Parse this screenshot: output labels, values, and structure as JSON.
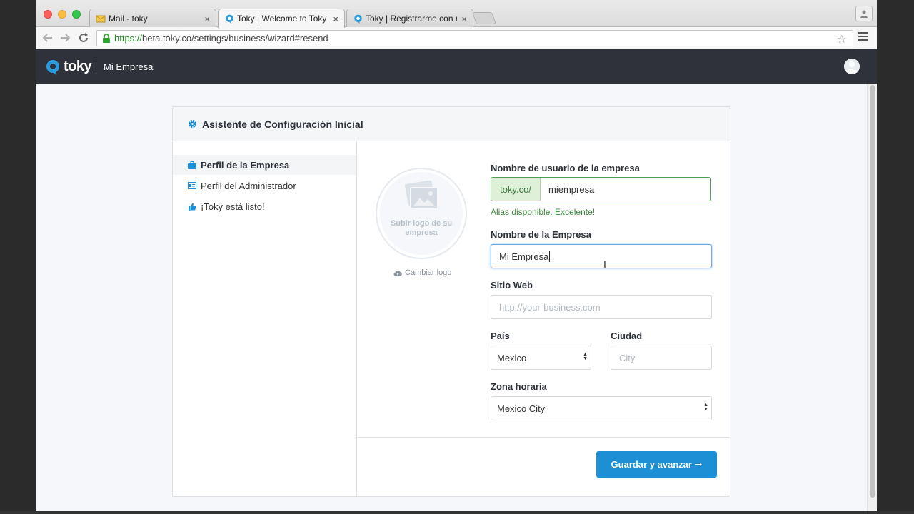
{
  "browser": {
    "tabs": [
      {
        "title": "Mail - toky",
        "close": "×",
        "icon": "mail-icon"
      },
      {
        "title": "Toky | Welcome to Toky",
        "close": "×",
        "icon": "toky-favicon",
        "active": true
      },
      {
        "title": "Toky | Registrarme con mi c",
        "close": "×",
        "icon": "toky-favicon"
      }
    ],
    "url_scheme": "https://",
    "url_rest": "beta.toky.co/settings/business/wizard#resend"
  },
  "app": {
    "logo_text": "toky",
    "company_name": "Mi Empresa"
  },
  "wizard": {
    "title": "Asistente de Configuración Inicial",
    "steps": [
      {
        "label": "Perfil de la Empresa",
        "active": true,
        "icon": "briefcase-icon"
      },
      {
        "label": "Perfil del Administrador",
        "active": false,
        "icon": "id-card-icon"
      },
      {
        "label": "¡Toky está listo!",
        "active": false,
        "icon": "thumbs-up-icon"
      }
    ],
    "logo_upload_text": "Subir logo de su empresa",
    "change_logo_label": "Cambiar logo",
    "form": {
      "username_label": "Nombre de usuario de la empresa",
      "username_prefix": "toky.co/",
      "username_value": "miempresa",
      "username_status": "Alias disponible. Excelente!",
      "company_label": "Nombre de la Empresa",
      "company_value": "Mi Empresa",
      "website_label": "Sitio Web",
      "website_placeholder": "http://your-business.com",
      "country_label": "País",
      "country_value": "Mexico",
      "city_label": "Ciudad",
      "city_placeholder": "City",
      "timezone_label": "Zona horaria",
      "timezone_value": "Mexico City"
    },
    "save_button": "Guardar y avanzar ➞"
  },
  "colors": {
    "header_bg": "#2f323b",
    "primary": "#1d8fd5",
    "success": "#3c763d",
    "success_bg": "#dff0d8"
  }
}
